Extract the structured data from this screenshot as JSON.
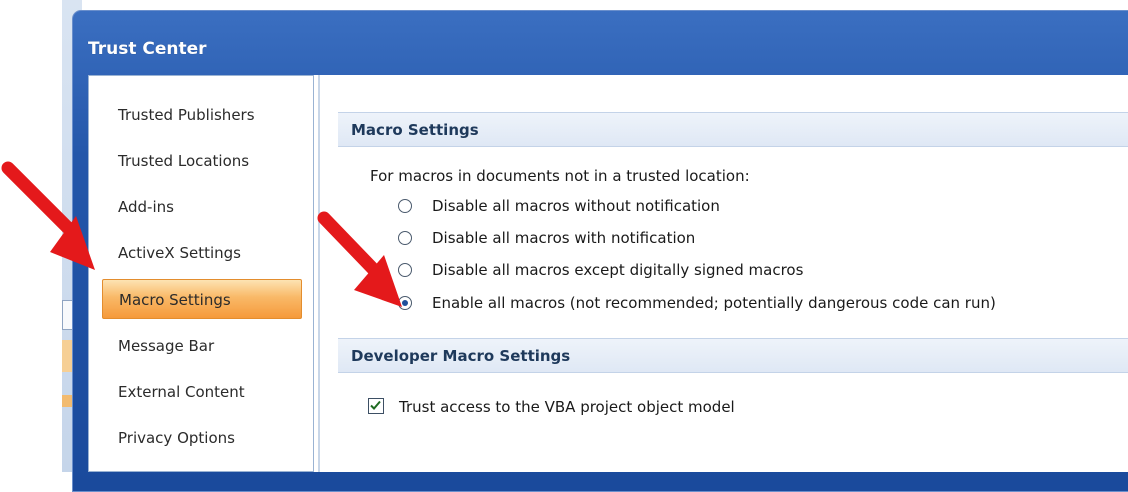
{
  "dialog": {
    "title": "Trust Center"
  },
  "sidebar": {
    "items": [
      {
        "label": "Trusted Publishers",
        "selected": false
      },
      {
        "label": "Trusted Locations",
        "selected": false
      },
      {
        "label": "Add-ins",
        "selected": false
      },
      {
        "label": "ActiveX Settings",
        "selected": false
      },
      {
        "label": "Macro Settings",
        "selected": true
      },
      {
        "label": "Message Bar",
        "selected": false
      },
      {
        "label": "External Content",
        "selected": false
      },
      {
        "label": "Privacy Options",
        "selected": false
      }
    ]
  },
  "macro_settings": {
    "header": "Macro Settings",
    "intro": "For macros in documents not in a trusted location:",
    "options": [
      {
        "label": "Disable all macros without notification",
        "checked": false
      },
      {
        "label": "Disable all macros with notification",
        "checked": false
      },
      {
        "label": "Disable all macros except digitally signed macros",
        "checked": false
      },
      {
        "label": "Enable all macros (not recommended; potentially dangerous code can run)",
        "checked": true
      }
    ]
  },
  "developer_settings": {
    "header": "Developer Macro Settings",
    "trust_vba": {
      "label": "Trust access to the VBA project object model",
      "checked": true
    }
  },
  "colors": {
    "titlebar": "#2457aa",
    "selected_item": "#f9b968",
    "annotation_arrow": "#e4191b"
  }
}
